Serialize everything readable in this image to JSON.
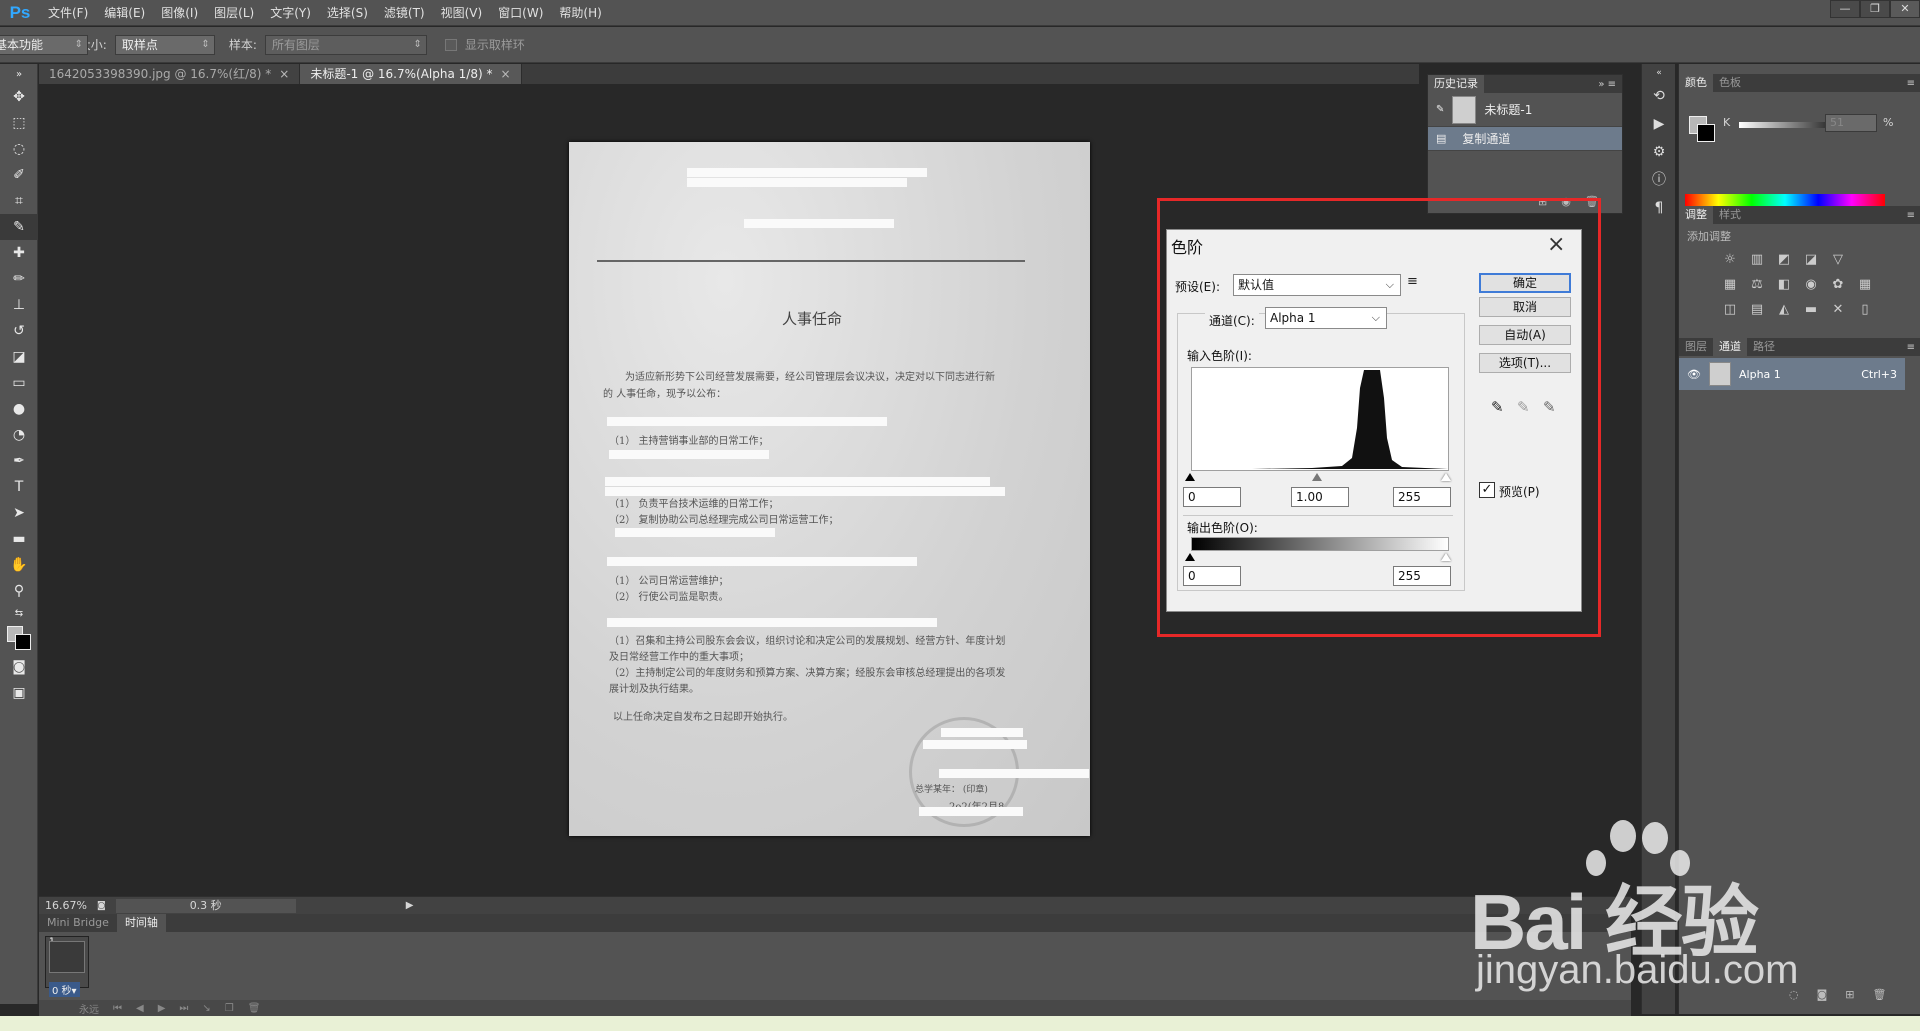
{
  "app": {
    "logo": "Ps"
  },
  "menu": [
    "文件(F)",
    "编辑(E)",
    "图像(I)",
    "图层(L)",
    "文字(Y)",
    "选择(S)",
    "滤镜(T)",
    "视图(V)",
    "窗口(W)",
    "帮助(H)"
  ],
  "window_controls": [
    "—",
    "❐",
    "✕"
  ],
  "options_bar": {
    "sample_size_label": "取样大小:",
    "sample_size_value": "取样点",
    "sample_label": "样本:",
    "sample_value": "所有图层",
    "show_ring_label": "显示取样环",
    "workspace": "基本功能"
  },
  "doc_tabs": [
    {
      "label": "1642053398390.jpg @ 16.7%(红/8) *",
      "active": false
    },
    {
      "label": "未标题-1 @ 16.7%(Alpha 1/8) *",
      "active": true
    }
  ],
  "document": {
    "title": "人事任命",
    "intro_line1": "为适应新形势下公司经营发展需要，经公司管理层会议决议，决定对以下同志进行新",
    "intro_line2": "的 人事任命，现予以公布：",
    "lines": [
      "（1）  主持营销事业部的日常工作；",
      "（1）  负责平台技术运维的日常工作；",
      "（2）  复制协助公司总经理完成公司日常运营工作；",
      "（1）  公司日常运营维护；",
      "（2）  行使公司监是职责。",
      "（1）召集和主持公司股东会会议，组织讨论和决定公司的发展规划、经营方针、年度计划",
      "及日常经营工作中的重大事项；",
      "（2）主持制定公司的年度财务和预算方案、决算方案；经股东会审核总经理提出的各项发",
      "展计划及执行结果。",
      "以上任命决定自发布之日起即开始执行。"
    ],
    "signature_text": "总学某年：    (印章)",
    "signature_date": "2o2(年2月8"
  },
  "statusbar": {
    "zoom": "16.67%",
    "time": "0.3 秒"
  },
  "timeline": {
    "tabs": [
      "Mini Bridge",
      "时间轴"
    ],
    "frame_number": "1",
    "frame_delay": "0 秒▾",
    "loop": "永远"
  },
  "history_panel": {
    "tab": "历史记录",
    "items": [
      "未标题-1",
      "复制通道"
    ]
  },
  "color_panel": {
    "tabs": [
      "颜色",
      "色板"
    ],
    "k_label": "K",
    "k_value": "51",
    "unit": "%"
  },
  "adjust_panel": {
    "tabs": [
      "调整",
      "样式"
    ],
    "subtitle": "添加调整"
  },
  "layers_panel": {
    "tabs": [
      "图层",
      "通道",
      "路径"
    ],
    "channel_name": "Alpha 1",
    "channel_shortcut": "Ctrl+3"
  },
  "levels_dialog": {
    "title": "色阶",
    "preset_label": "预设(E):",
    "preset_value": "默认值",
    "channel_label": "通道(C):",
    "channel_value": "Alpha 1",
    "input_label": "输入色阶(I):",
    "input_black": "0",
    "input_gamma": "1.00",
    "input_white": "255",
    "output_label": "输出色阶(O):",
    "output_black": "0",
    "output_white": "255",
    "buttons": {
      "ok": "确定",
      "cancel": "取消",
      "auto": "自动(A)",
      "options": "选项(T)..."
    },
    "preview_label": "预览(P)",
    "preview_checked": "✓"
  },
  "watermark": {
    "logo": "Bai  经验",
    "url": "jingyan.baidu.com"
  }
}
